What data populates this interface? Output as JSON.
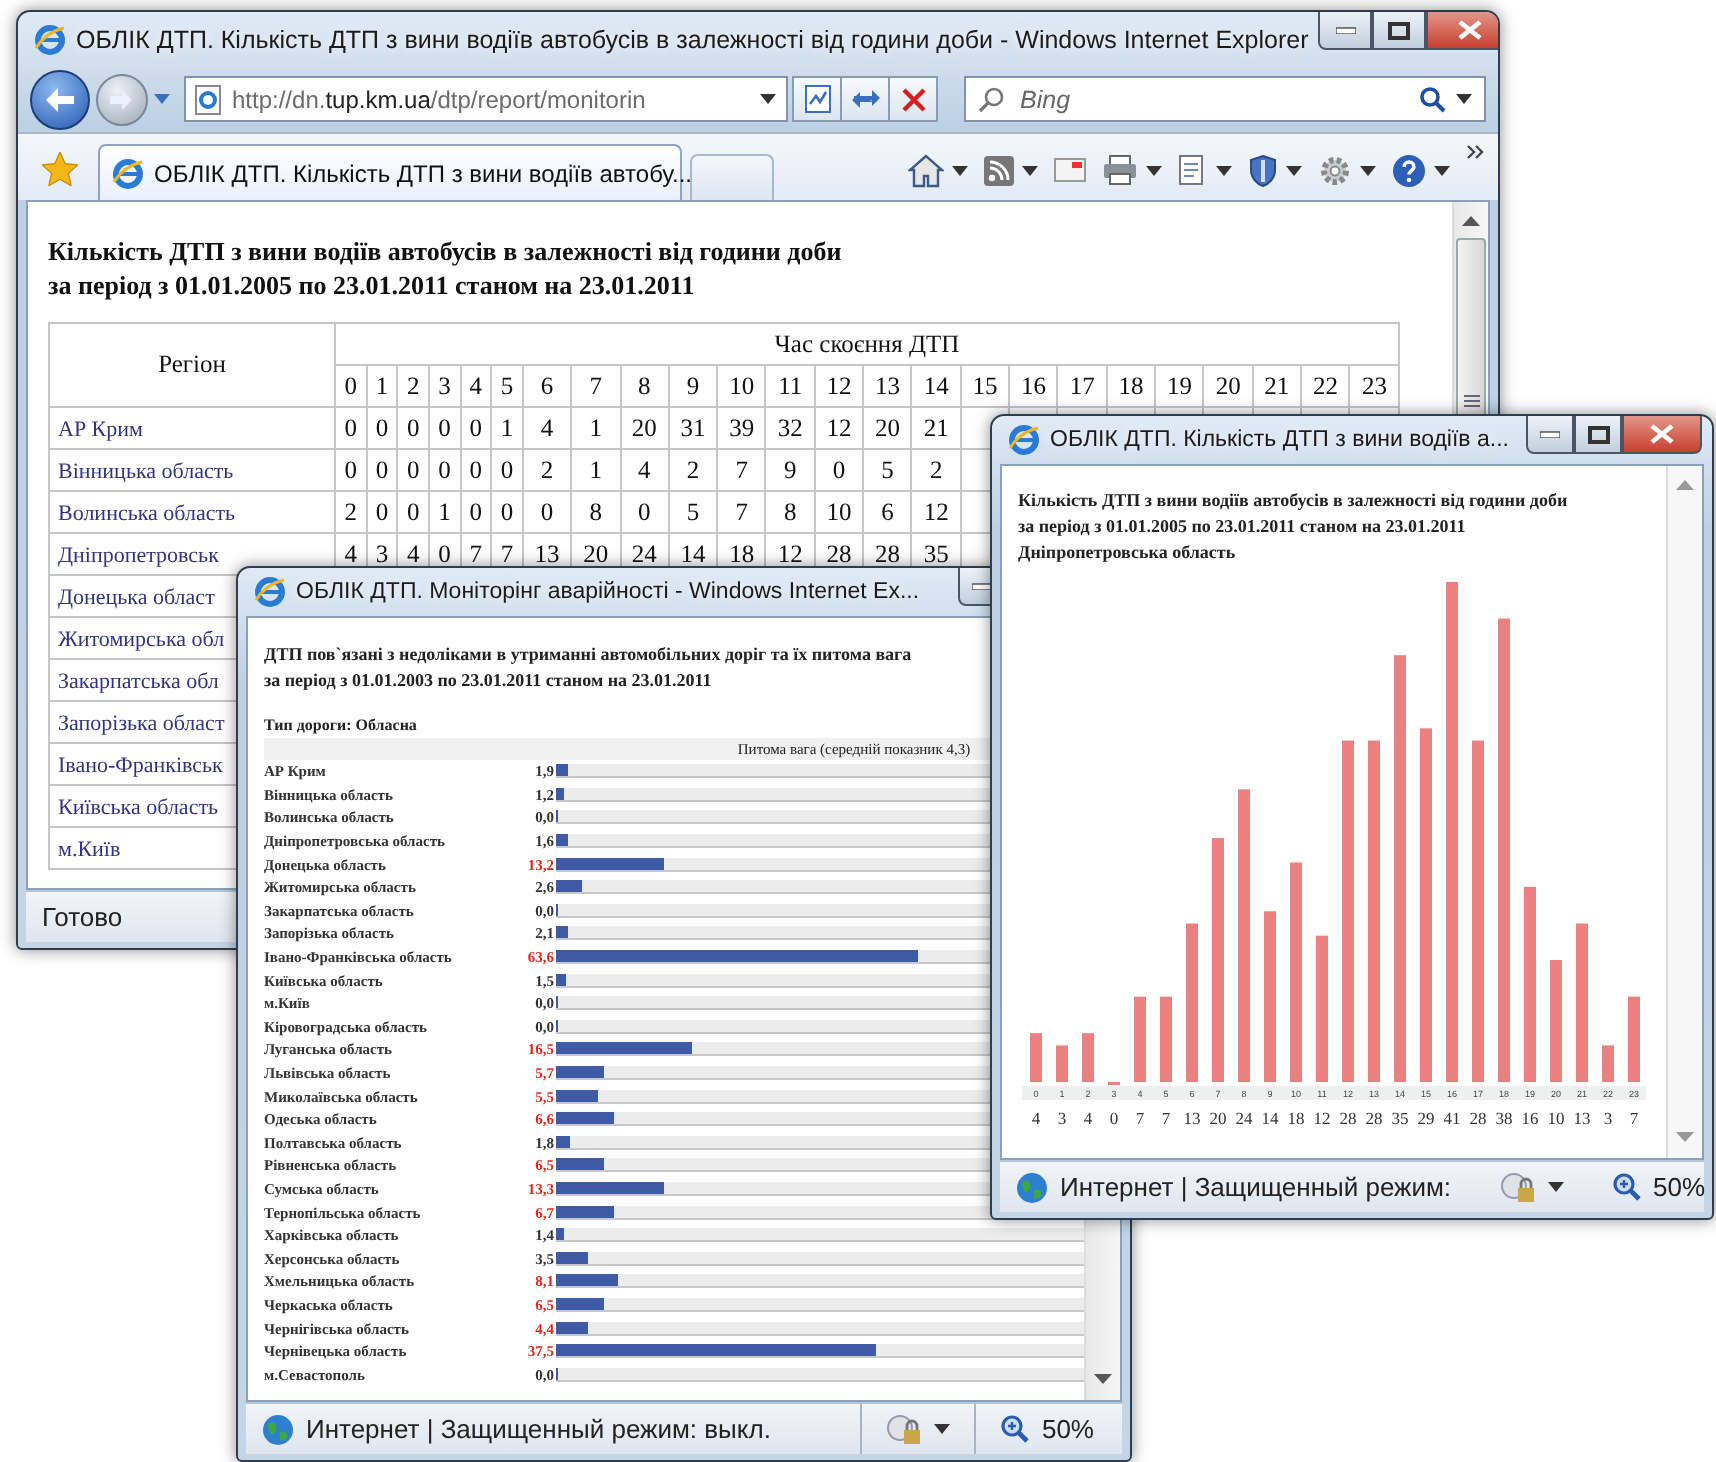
{
  "main_window": {
    "title": "ОБЛІК ДТП. Кількість ДТП з вини водіїв автобусів в залежності від години доби - Windows Internet Explorer",
    "address": "http://dn.**tup.km.ua**/dtp/report/monitorin",
    "search": {
      "placeholder": "Bing"
    },
    "tab_title": "ОБЛІК ДТП. Кількість ДТП з вини водіїв автобу...",
    "heading": [
      "Кількість ДТП з вини водіїв автобусів в залежності від години доби",
      "за період з 01.01.2005 по 23.01.2011 станом на 23.01.2011"
    ],
    "table": {
      "region_header": "Регіон",
      "time_header": "Час скоєння ДТП",
      "hours": [
        "0",
        "1",
        "2",
        "3",
        "4",
        "5",
        "6",
        "7",
        "8",
        "9",
        "10",
        "11",
        "12",
        "13",
        "14",
        "15",
        "16",
        "17",
        "18",
        "19",
        "20",
        "21",
        "22",
        "23"
      ],
      "rows": [
        {
          "region": "АР Крим",
          "values": [
            "0",
            "0",
            "0",
            "0",
            "0",
            "1",
            "4",
            "1",
            "20",
            "31",
            "39",
            "32",
            "12",
            "20",
            "21"
          ]
        },
        {
          "region": "Вінницька область",
          "values": [
            "0",
            "0",
            "0",
            "0",
            "0",
            "0",
            "2",
            "1",
            "4",
            "2",
            "7",
            "9",
            "0",
            "5",
            "2"
          ]
        },
        {
          "region": "Волинська область",
          "values": [
            "2",
            "0",
            "0",
            "1",
            "0",
            "0",
            "0",
            "8",
            "0",
            "5",
            "7",
            "8",
            "10",
            "6",
            "12"
          ]
        },
        {
          "region": "Дніпропетровськ",
          "values": [
            "4",
            "3",
            "4",
            "0",
            "7",
            "7",
            "13",
            "20",
            "24",
            "14",
            "18",
            "12",
            "28",
            "28",
            "35"
          ]
        },
        {
          "region": "Донецька област"
        },
        {
          "region": "Житомирська обл"
        },
        {
          "region": "Закарпатська обл"
        },
        {
          "region": "Запорізька област"
        },
        {
          "region": "Івано-Франківськ"
        },
        {
          "region": "Київська область"
        },
        {
          "region": "м.Київ"
        }
      ]
    },
    "status": "Готово"
  },
  "monitoring_window": {
    "title": "ОБЛІК ДТП. Моніторінг аварійності - Windows Internet Ex...",
    "heading": [
      "ДТП пов`язані з недоліками в утриманні автомобільних доріг та їх питома вага",
      "за період з 01.01.2003 по 23.01.2011 станом на 23.01.2011"
    ],
    "road_type": "Тип дороги: Обласна",
    "column_header": "Питома вага (середній показник 4,3)",
    "rows": [
      {
        "region": "АР Крим",
        "value": "1,9",
        "above_average": false,
        "level": 0.022
      },
      {
        "region": "Вінницька область",
        "value": "1,2",
        "above_average": false,
        "level": 0.015
      },
      {
        "region": "Волинська область",
        "value": "0,0",
        "above_average": false,
        "level": 0.004
      },
      {
        "region": "Дніпропетровська область",
        "value": "1,6",
        "above_average": false,
        "level": 0.02
      },
      {
        "region": "Донецька область",
        "value": "13,2",
        "above_average": true,
        "level": 0.19
      },
      {
        "region": "Житомирська область",
        "value": "2,6",
        "above_average": false,
        "level": 0.045
      },
      {
        "region": "Закарпатська область",
        "value": "0,0",
        "above_average": false,
        "level": 0.004
      },
      {
        "region": "Запорізька область",
        "value": "2,1",
        "above_average": false,
        "level": 0.02
      },
      {
        "region": "Івано-Франківська область",
        "value": "63,6",
        "above_average": true,
        "level": 0.635
      },
      {
        "region": "Київська область",
        "value": "1,5",
        "above_average": false,
        "level": 0.018
      },
      {
        "region": "м.Київ",
        "value": "0,0",
        "above_average": false,
        "level": 0.004
      },
      {
        "region": "Кіровоградська область",
        "value": "0,0",
        "above_average": false,
        "level": 0.004
      },
      {
        "region": "Луганська область",
        "value": "16,5",
        "above_average": true,
        "level": 0.24
      },
      {
        "region": "Львівська область",
        "value": "5,7",
        "above_average": true,
        "level": 0.085
      },
      {
        "region": "Миколаївська область",
        "value": "5,5",
        "above_average": true,
        "level": 0.075
      },
      {
        "region": "Одеська область",
        "value": "6,6",
        "above_average": true,
        "level": 0.1
      },
      {
        "region": "Полтавська область",
        "value": "1,8",
        "above_average": false,
        "level": 0.025
      },
      {
        "region": "Рівненська область",
        "value": "6,5",
        "above_average": true,
        "level": 0.085
      },
      {
        "region": "Сумська область",
        "value": "13,3",
        "above_average": true,
        "level": 0.19
      },
      {
        "region": "Тернопільська область",
        "value": "6,7",
        "above_average": true,
        "level": 0.1
      },
      {
        "region": "Харківська область",
        "value": "1,4",
        "above_average": false,
        "level": 0.015
      },
      {
        "region": "Херсонська область",
        "value": "3,5",
        "above_average": false,
        "level": 0.055
      },
      {
        "region": "Хмельницька область",
        "value": "8,1",
        "above_average": true,
        "level": 0.11
      },
      {
        "region": "Черкаська область",
        "value": "6,5",
        "above_average": true,
        "level": 0.085
      },
      {
        "region": "Чернігівська область",
        "value": "4,4",
        "above_average": true,
        "level": 0.055
      },
      {
        "region": "Чернівецька область",
        "value": "37,5",
        "above_average": true,
        "level": 0.56
      },
      {
        "region": "м.Севастополь",
        "value": "0,0",
        "above_average": false,
        "level": 0.004
      }
    ],
    "status": "Интернет | Защищенный режим: выкл.",
    "zoom": "50%"
  },
  "chart_window": {
    "title": "ОБЛІК ДТП. Кількість ДТП з вини водіїв а...",
    "heading": [
      "Кількість ДТП з вини водіїв автобусів в залежності від години доби",
      "за період з 01.01.2005 по 23.01.2011 станом на 23.01.2011",
      "Дніпропетровська область"
    ],
    "chart_data": {
      "type": "bar",
      "categories": [
        "0",
        "1",
        "2",
        "3",
        "4",
        "5",
        "6",
        "7",
        "8",
        "9",
        "10",
        "11",
        "12",
        "13",
        "14",
        "15",
        "16",
        "17",
        "18",
        "19",
        "20",
        "21",
        "22",
        "23"
      ],
      "values": [
        4,
        3,
        4,
        0,
        7,
        7,
        13,
        20,
        24,
        14,
        18,
        12,
        28,
        28,
        35,
        29,
        41,
        28,
        38,
        16,
        10,
        13,
        3,
        7
      ],
      "data_labels": true
    },
    "status": "Интернет | Защищенный режим:",
    "zoom": "50%"
  }
}
